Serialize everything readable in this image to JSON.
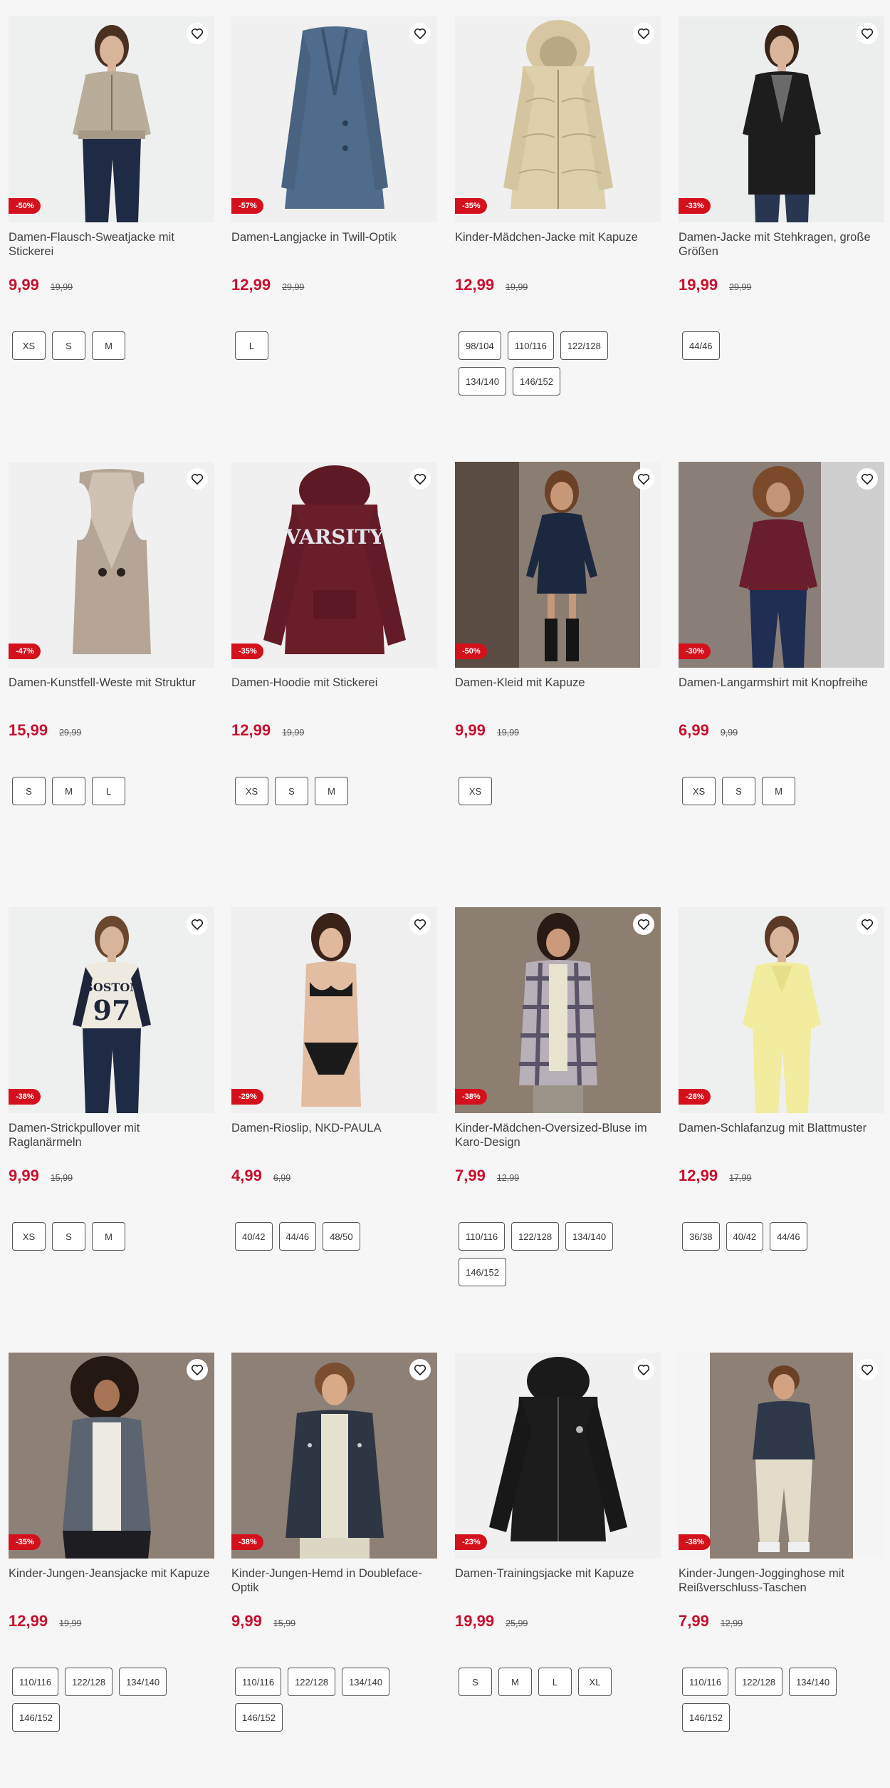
{
  "products": [
    {
      "title": "Damen-Flausch-Sweatjacke mit Stickerei",
      "price": "9,99",
      "old_price": "19,99",
      "discount": "-50%",
      "sizes": [
        "XS",
        "S",
        "M"
      ],
      "image": "model-beige-sweatjacket",
      "bg": "#eef0f0"
    },
    {
      "title": "Damen-Langjacke in Twill-Optik",
      "price": "12,99",
      "old_price": "29,99",
      "discount": "-57%",
      "sizes": [
        "L"
      ],
      "image": "blue-long-coat",
      "bg": "#f0f0f0"
    },
    {
      "title": "Kinder-Mädchen-Jacke mit Kapuze",
      "price": "12,99",
      "old_price": "19,99",
      "discount": "-35%",
      "sizes": [
        "98/104",
        "110/116",
        "122/128",
        "134/140",
        "146/152"
      ],
      "image": "gold-quilted-jacket",
      "bg": "#f0f0f0"
    },
    {
      "title": "Damen-Jacke mit Stehkragen, große Größen",
      "price": "19,99",
      "old_price": "29,99",
      "discount": "-33%",
      "sizes": [
        "44/46"
      ],
      "image": "model-black-coat",
      "bg": "#eceeee"
    },
    {
      "title": "Damen-Kunstfell-Weste mit Struktur",
      "price": "15,99",
      "old_price": "29,99",
      "discount": "-47%",
      "sizes": [
        "S",
        "M",
        "L"
      ],
      "image": "teddy-vest",
      "bg": "#f0f0f0"
    },
    {
      "title": "Damen-Hoodie mit Stickerei",
      "price": "12,99",
      "old_price": "19,99",
      "discount": "-35%",
      "sizes": [
        "XS",
        "S",
        "M"
      ],
      "image": "burgundy-hoodie",
      "bg": "#f0f0f0"
    },
    {
      "title": "Damen-Kleid mit Kapuze",
      "price": "9,99",
      "old_price": "19,99",
      "discount": "-50%",
      "sizes": [
        "XS"
      ],
      "image": "model-navy-dress",
      "bg": "#8a7d72"
    },
    {
      "title": "Damen-Langarmshirt mit Knopfreihe",
      "price": "6,99",
      "old_price": "9,99",
      "discount": "-30%",
      "sizes": [
        "XS",
        "S",
        "M"
      ],
      "image": "model-burgundy-shirt",
      "bg": "#8a7f78"
    },
    {
      "title": "Damen-Strickpullover mit Raglanärmeln",
      "price": "9,99",
      "old_price": "15,99",
      "discount": "-38%",
      "sizes": [
        "XS",
        "S",
        "M"
      ],
      "image": "model-boston-sweater",
      "bg": "#eef0f0"
    },
    {
      "title": "Damen-Rioslip, NKD-PAULA",
      "price": "4,99",
      "old_price": "6,99",
      "discount": "-29%",
      "sizes": [
        "40/42",
        "44/46",
        "48/50"
      ],
      "image": "model-black-lingerie",
      "bg": "#efefef"
    },
    {
      "title": "Kinder-Mädchen-Oversized-Bluse im Karo-Design",
      "price": "7,99",
      "old_price": "12,99",
      "discount": "-38%",
      "sizes": [
        "110/116",
        "122/128",
        "134/140",
        "146/152"
      ],
      "image": "child-plaid-blouse",
      "bg": "#8c7e70"
    },
    {
      "title": "Damen-Schlafanzug mit Blattmuster",
      "price": "12,99",
      "old_price": "17,99",
      "discount": "-28%",
      "sizes": [
        "36/38",
        "40/42",
        "44/46"
      ],
      "image": "model-yellow-pyjama",
      "bg": "#eef0f0"
    },
    {
      "title": "Kinder-Jungen-Jeansjacke mit Kapuze",
      "price": "12,99",
      "old_price": "19,99",
      "discount": "-35%",
      "sizes": [
        "110/116",
        "122/128",
        "134/140",
        "146/152"
      ],
      "image": "child-denim-jacket",
      "bg": "#8d8076"
    },
    {
      "title": "Kinder-Jungen-Hemd in Doubleface-Optik",
      "price": "9,99",
      "old_price": "15,99",
      "discount": "-38%",
      "sizes": [
        "110/116",
        "122/128",
        "134/140",
        "146/152"
      ],
      "image": "child-navy-shirt",
      "bg": "#8d8076"
    },
    {
      "title": "Damen-Trainingsjacke mit Kapuze",
      "price": "19,99",
      "old_price": "25,99",
      "discount": "-23%",
      "sizes": [
        "S",
        "M",
        "L",
        "XL"
      ],
      "image": "black-track-jacket",
      "bg": "#f0f0f0"
    },
    {
      "title": "Kinder-Jungen-Jogginghose mit Reißverschluss-Taschen",
      "price": "7,99",
      "old_price": "12,99",
      "discount": "-38%",
      "sizes": [
        "110/116",
        "122/128",
        "134/140",
        "146/152"
      ],
      "image": "child-jogger-pants",
      "bg": "#8d8076"
    }
  ],
  "icons": {
    "wishlist": "heart-outline-icon"
  },
  "colors": {
    "price": "#c8102e",
    "badge": "#d4101c"
  }
}
